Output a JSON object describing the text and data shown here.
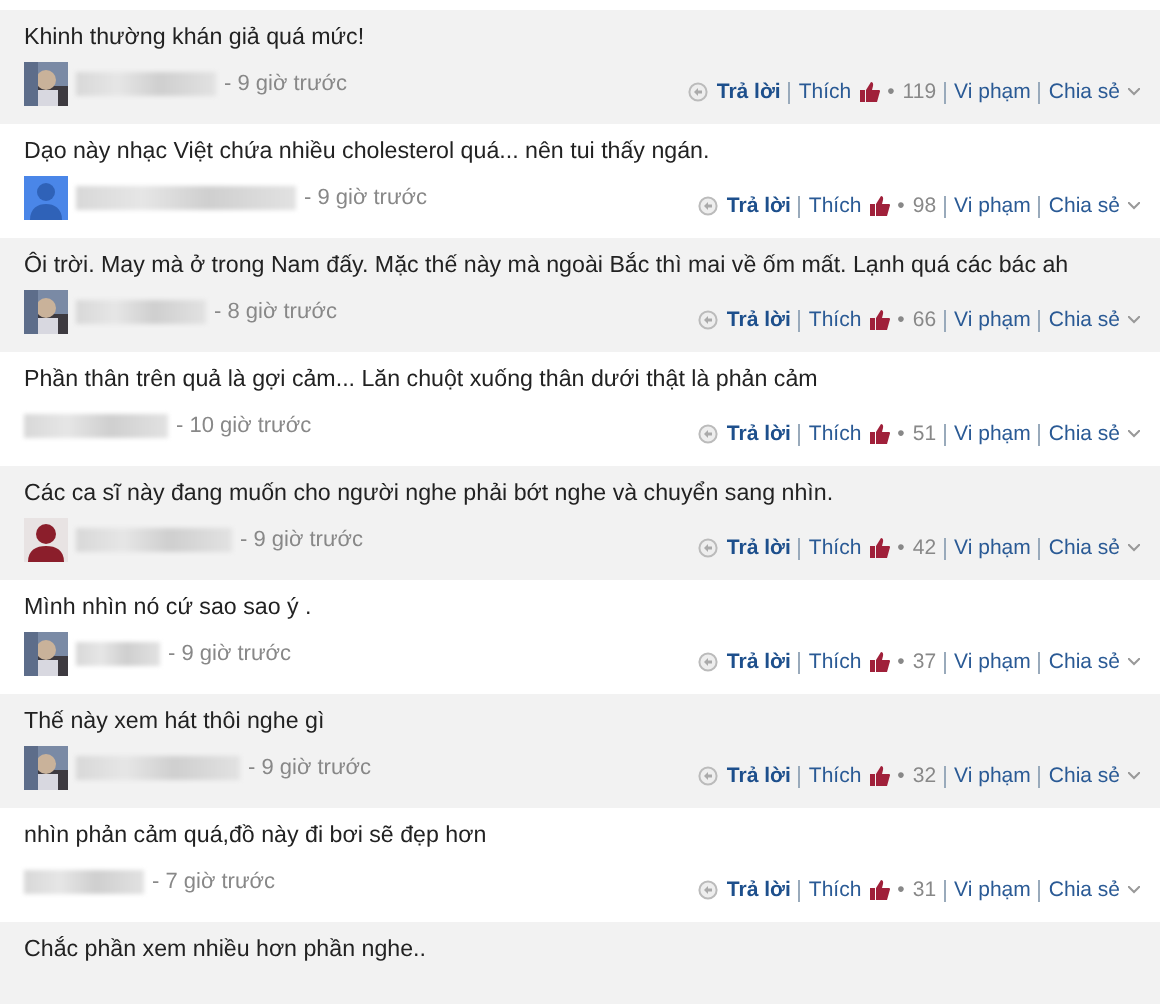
{
  "comments": [
    {
      "text": "Khinh thường khán giả quá mức!",
      "time": "- 9 giờ trước",
      "reply": "Trả lời",
      "like": "Thích",
      "dot": "•",
      "likes": "119",
      "report": "Vi phạm",
      "share": "Chia sẻ"
    },
    {
      "text": "Dạo này nhạc Việt chứa nhiều cholesterol quá... nên tui thấy ngán.",
      "kind": "default",
      "time": "- 9 giờ trước",
      "reply": "Trả lời",
      "like": "Thích",
      "dot": "•",
      "likes": "98",
      "report": "Vi phạm",
      "share": "Chia sẻ"
    },
    {
      "text": "Ôi trời. May mà ở trong Nam đấy. Mặc thế này mà ngoài Bắc thì mai về ốm mất. Lạnh quá các bác ah",
      "time": "- 8 giờ trước",
      "reply": "Trả lời",
      "like": "Thích",
      "dot": "•",
      "likes": "66",
      "report": "Vi phạm",
      "share": "Chia sẻ"
    },
    {
      "text": "Phần thân trên quả là gợi cảm... Lăn chuột xuống thân dưới thật là phản cảm",
      "time": "- 10 giờ trước",
      "reply": "Trả lời",
      "like": "Thích",
      "dot": "•",
      "likes": "51",
      "report": "Vi phạm",
      "share": "Chia sẻ"
    },
    {
      "text": "Các ca sĩ này đang muốn cho người nghe phải bớt nghe và chuyển sang nhìn.",
      "kind": "silhouette",
      "time": "- 9 giờ trước",
      "reply": "Trả lời",
      "like": "Thích",
      "dot": "•",
      "likes": "42",
      "report": "Vi phạm",
      "share": "Chia sẻ"
    },
    {
      "text": "Mình nhìn nó cứ sao sao ý .",
      "time": "- 9 giờ trước",
      "reply": "Trả lời",
      "like": "Thích",
      "dot": "•",
      "likes": "37",
      "report": "Vi phạm",
      "share": "Chia sẻ"
    },
    {
      "text": "Thế này xem hát thôi nghe gì",
      "time": "- 9 giờ trước",
      "reply": "Trả lời",
      "like": "Thích",
      "dot": "•",
      "likes": "32",
      "report": "Vi phạm",
      "share": "Chia sẻ"
    },
    {
      "text": "nhìn phản cảm quá,đồ này đi bơi sẽ đẹp hơn",
      "time": "- 7 giờ trước",
      "reply": "Trả lời",
      "like": "Thích",
      "dot": "•",
      "likes": "31",
      "report": "Vi phạm",
      "share": "Chia sẻ"
    },
    {
      "text": "Chắc phần xem nhiều hơn phần nghe.."
    }
  ]
}
